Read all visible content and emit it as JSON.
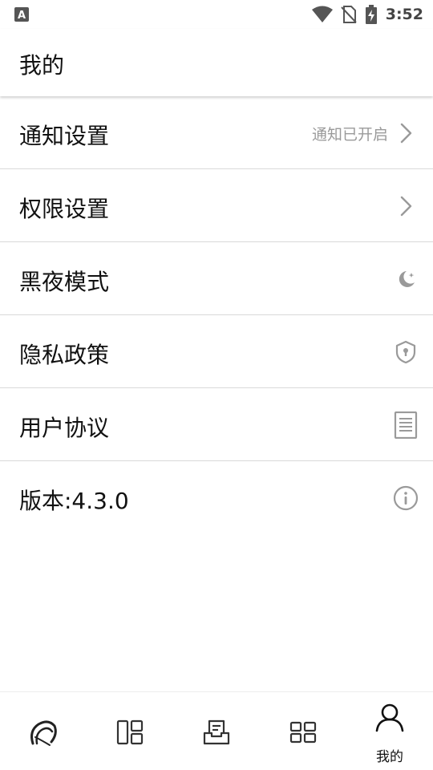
{
  "status_bar": {
    "time": "3:52",
    "icons": [
      "app-notification-icon",
      "wifi-icon",
      "no-sim-icon",
      "battery-charging-icon"
    ]
  },
  "header": {
    "title": "我的"
  },
  "menu": [
    {
      "label": "通知设置",
      "status": "通知已开启",
      "icon": "chevron-right-icon"
    },
    {
      "label": "权限设置",
      "icon": "chevron-right-icon"
    },
    {
      "label": "黑夜模式",
      "icon": "moon-icon"
    },
    {
      "label": "隐私政策",
      "icon": "shield-icon"
    },
    {
      "label": "用户协议",
      "icon": "document-icon"
    },
    {
      "label": "版本:4.3.0",
      "icon": "info-icon"
    }
  ],
  "bottom_nav": {
    "active_index": 4,
    "items": [
      {
        "icon": "app-logo-icon",
        "label": ""
      },
      {
        "icon": "layout-icon",
        "label": ""
      },
      {
        "icon": "inbox-icon",
        "label": ""
      },
      {
        "icon": "grid-icon",
        "label": ""
      },
      {
        "icon": "user-icon",
        "label": "我的"
      }
    ]
  }
}
